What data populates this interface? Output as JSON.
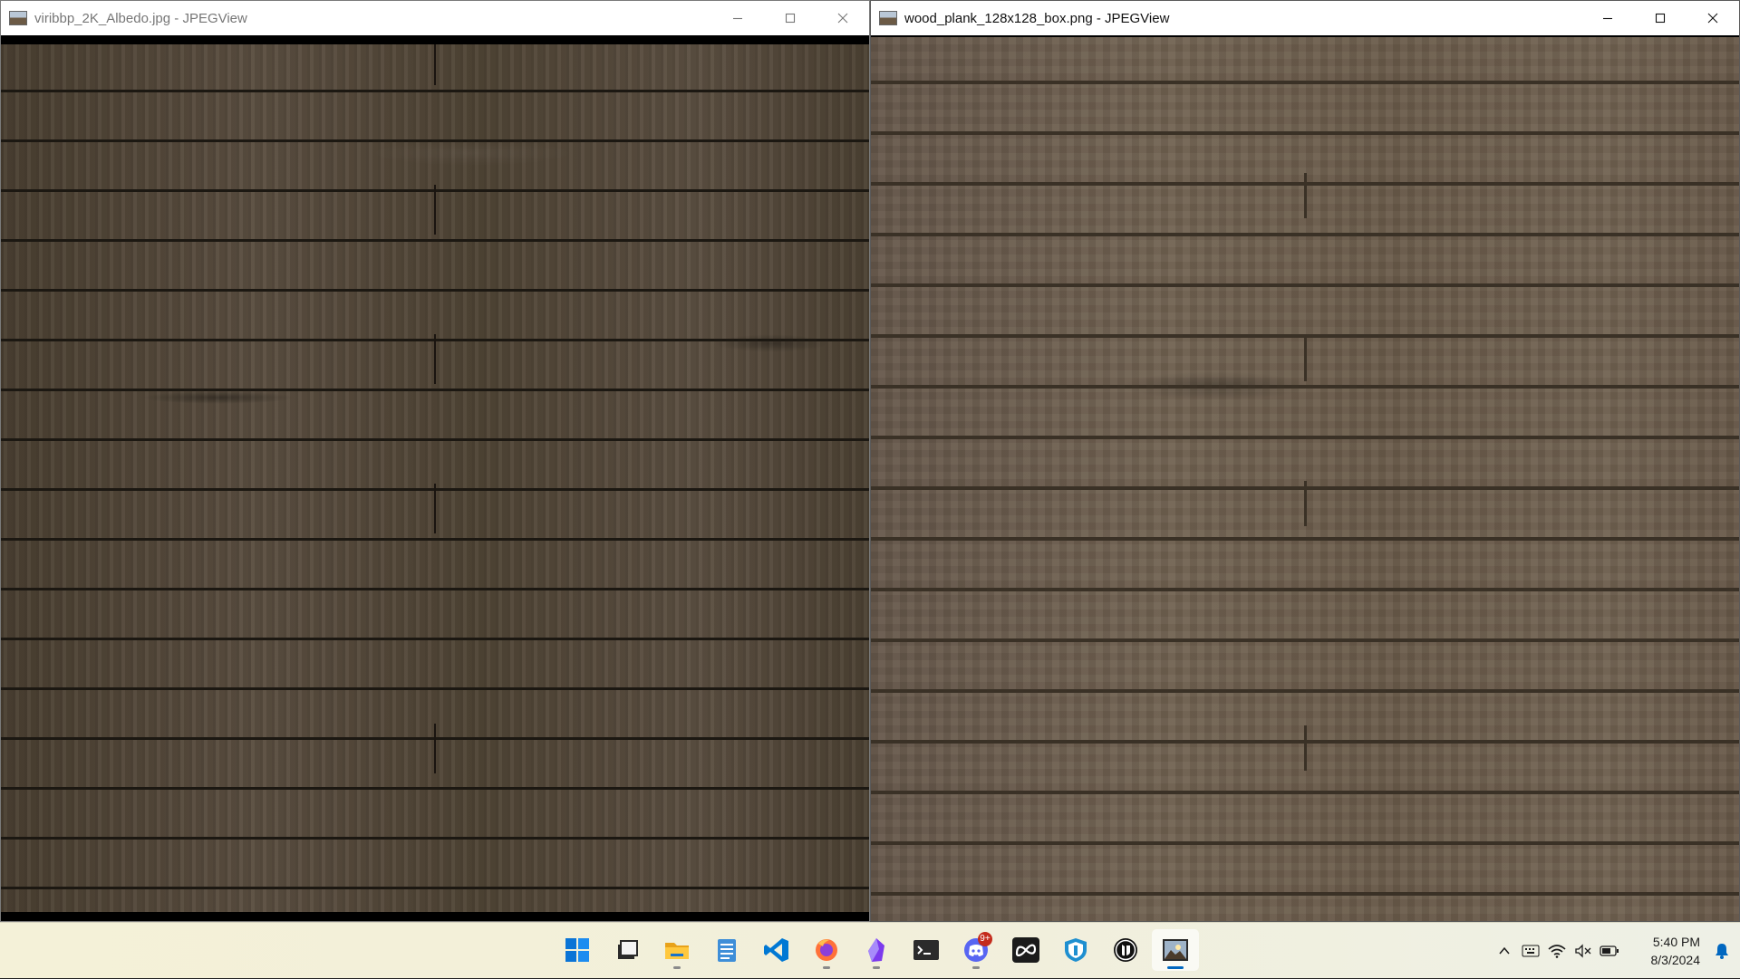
{
  "windows": [
    {
      "title": "viribbp_2K_Albedo.jpg - JPEGView"
    },
    {
      "title": "wood_plank_128x128_box.png - JPEGView"
    }
  ],
  "window_controls": {
    "minimize": "minimize-icon",
    "maximize": "maximize-icon",
    "close": "close-icon"
  },
  "taskbar": {
    "apps": [
      {
        "name": "start",
        "icon": "windows-logo-icon"
      },
      {
        "name": "task-view",
        "icon": "task-view-icon"
      },
      {
        "name": "file-explorer",
        "icon": "folder-icon"
      },
      {
        "name": "notepad",
        "icon": "notepad-icon"
      },
      {
        "name": "visual-studio-code",
        "icon": "vscode-icon"
      },
      {
        "name": "firefox",
        "icon": "firefox-icon"
      },
      {
        "name": "obsidian",
        "icon": "obsidian-icon"
      },
      {
        "name": "terminal",
        "icon": "terminal-icon"
      },
      {
        "name": "discord",
        "icon": "discord-icon",
        "badge": "9+"
      },
      {
        "name": "meta",
        "icon": "meta-icon"
      },
      {
        "name": "app-shield",
        "icon": "shield-app-icon"
      },
      {
        "name": "unreal-engine",
        "icon": "unreal-icon"
      },
      {
        "name": "jpegview",
        "icon": "jpegview-icon"
      }
    ],
    "tray": {
      "icons": [
        "chevron-up-icon",
        "keyboard-icon",
        "wifi-icon",
        "speaker-muted-icon",
        "battery-icon"
      ],
      "time": "5:40 PM",
      "date": "8/3/2024",
      "notification": "bell-icon"
    }
  },
  "colors": {
    "accent": "#0067c0",
    "badge": "#c42b1c",
    "discord": "#5865f2",
    "vscode": "#0078d4",
    "firefox": "#ff7139",
    "obsidian": "#7c3aed"
  }
}
